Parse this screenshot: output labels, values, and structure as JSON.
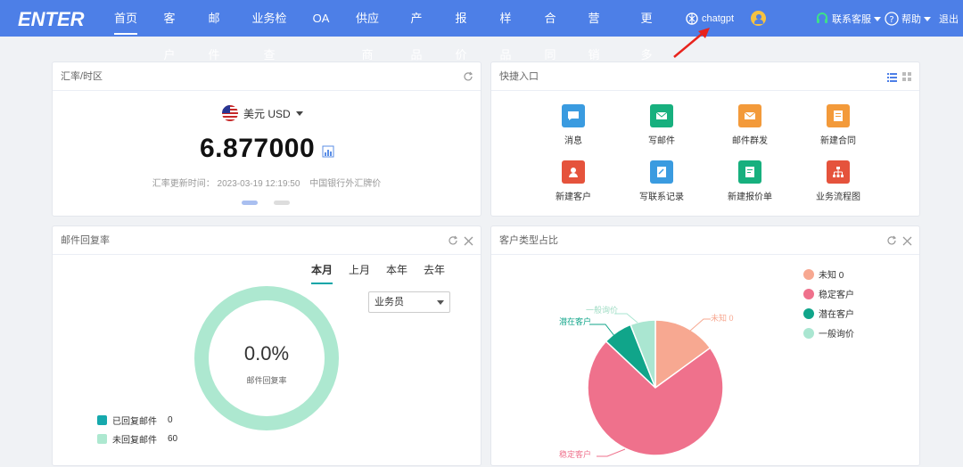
{
  "nav": {
    "logo": "ENTER",
    "items": [
      "首页",
      "客户",
      "邮件",
      "业务检查",
      "OA",
      "供应商",
      "产品",
      "报价",
      "样品",
      "合同",
      "营销",
      "更多"
    ],
    "chatgpt": "chatgpt",
    "service": "联系客服",
    "help": "帮助",
    "logout": "退出"
  },
  "exchange": {
    "title": "汇率/时区",
    "currency": "美元 USD",
    "rate": "6.877000",
    "updated": "汇率更新时间： 2023-03-19 12:19:50",
    "source": "中国银行外汇牌价"
  },
  "quick": {
    "title": "快捷入口",
    "items": [
      "消息",
      "写邮件",
      "邮件群发",
      "新建合同",
      "新建客户",
      "写联系记录",
      "新建报价单",
      "业务流程图"
    ]
  },
  "mail": {
    "title": "邮件回复率",
    "tabs": [
      "本月",
      "上月",
      "本年",
      "去年"
    ],
    "select": "业务员",
    "percent": "0.0%",
    "center_label": "邮件回复率",
    "legend": [
      {
        "label": "已回复邮件",
        "value": "0",
        "color": "#16a9ad"
      },
      {
        "label": "未回复邮件",
        "value": "60",
        "color": "#ade8d0"
      }
    ]
  },
  "customer": {
    "title": "客户类型占比",
    "legend": [
      "未知 0",
      "稳定客户",
      "潜在客户",
      "一般询价"
    ],
    "labels": {
      "unknown": "未知 0",
      "stable": "稳定客户",
      "potential": "潜在客户",
      "inquiry": "一般询价"
    },
    "colors": {
      "unknown": "#f7a891",
      "stable": "#ef718c",
      "potential": "#10a58a",
      "inquiry": "#aae6d1"
    }
  },
  "chart_data": [
    {
      "type": "pie",
      "categories": [
        "已回复邮件",
        "未回复邮件"
      ],
      "values": [
        0,
        60
      ]
    },
    {
      "type": "pie",
      "categories": [
        "未知",
        "稳定客户",
        "潜在客户",
        "一般询价"
      ],
      "values": [
        15,
        72,
        7,
        6
      ]
    }
  ]
}
